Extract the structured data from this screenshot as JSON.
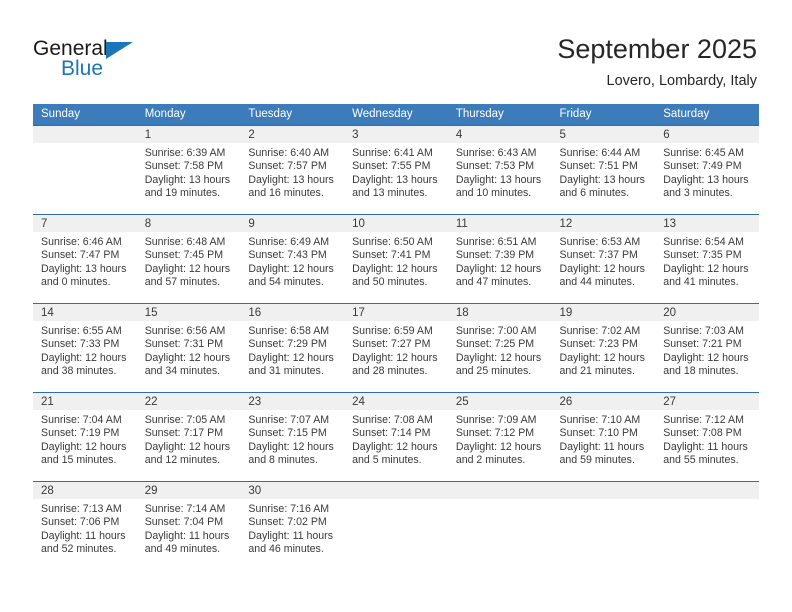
{
  "brand": {
    "name_top": "General",
    "name_bottom": "Blue",
    "accent_color": "#1b75bb",
    "triangle_icon": "triangle-icon"
  },
  "header": {
    "month_title": "September 2025",
    "location": "Lovero, Lombardy, Italy"
  },
  "theme": {
    "header_bg": "#3c7cba",
    "header_text": "#ffffff",
    "daynum_band_bg": "#f0f0f0",
    "week_separator": "#2f6fa8",
    "body_text": "#3a3a3a"
  },
  "weekday_headers": [
    "Sunday",
    "Monday",
    "Tuesday",
    "Wednesday",
    "Thursday",
    "Friday",
    "Saturday"
  ],
  "weeks": [
    [
      {
        "day": "",
        "sunrise": "",
        "sunset": "",
        "daylight1": "",
        "daylight2": ""
      },
      {
        "day": "1",
        "sunrise": "Sunrise: 6:39 AM",
        "sunset": "Sunset: 7:58 PM",
        "daylight1": "Daylight: 13 hours",
        "daylight2": "and 19 minutes."
      },
      {
        "day": "2",
        "sunrise": "Sunrise: 6:40 AM",
        "sunset": "Sunset: 7:57 PM",
        "daylight1": "Daylight: 13 hours",
        "daylight2": "and 16 minutes."
      },
      {
        "day": "3",
        "sunrise": "Sunrise: 6:41 AM",
        "sunset": "Sunset: 7:55 PM",
        "daylight1": "Daylight: 13 hours",
        "daylight2": "and 13 minutes."
      },
      {
        "day": "4",
        "sunrise": "Sunrise: 6:43 AM",
        "sunset": "Sunset: 7:53 PM",
        "daylight1": "Daylight: 13 hours",
        "daylight2": "and 10 minutes."
      },
      {
        "day": "5",
        "sunrise": "Sunrise: 6:44 AM",
        "sunset": "Sunset: 7:51 PM",
        "daylight1": "Daylight: 13 hours",
        "daylight2": "and 6 minutes."
      },
      {
        "day": "6",
        "sunrise": "Sunrise: 6:45 AM",
        "sunset": "Sunset: 7:49 PM",
        "daylight1": "Daylight: 13 hours",
        "daylight2": "and 3 minutes."
      }
    ],
    [
      {
        "day": "7",
        "sunrise": "Sunrise: 6:46 AM",
        "sunset": "Sunset: 7:47 PM",
        "daylight1": "Daylight: 13 hours",
        "daylight2": "and 0 minutes."
      },
      {
        "day": "8",
        "sunrise": "Sunrise: 6:48 AM",
        "sunset": "Sunset: 7:45 PM",
        "daylight1": "Daylight: 12 hours",
        "daylight2": "and 57 minutes."
      },
      {
        "day": "9",
        "sunrise": "Sunrise: 6:49 AM",
        "sunset": "Sunset: 7:43 PM",
        "daylight1": "Daylight: 12 hours",
        "daylight2": "and 54 minutes."
      },
      {
        "day": "10",
        "sunrise": "Sunrise: 6:50 AM",
        "sunset": "Sunset: 7:41 PM",
        "daylight1": "Daylight: 12 hours",
        "daylight2": "and 50 minutes."
      },
      {
        "day": "11",
        "sunrise": "Sunrise: 6:51 AM",
        "sunset": "Sunset: 7:39 PM",
        "daylight1": "Daylight: 12 hours",
        "daylight2": "and 47 minutes."
      },
      {
        "day": "12",
        "sunrise": "Sunrise: 6:53 AM",
        "sunset": "Sunset: 7:37 PM",
        "daylight1": "Daylight: 12 hours",
        "daylight2": "and 44 minutes."
      },
      {
        "day": "13",
        "sunrise": "Sunrise: 6:54 AM",
        "sunset": "Sunset: 7:35 PM",
        "daylight1": "Daylight: 12 hours",
        "daylight2": "and 41 minutes."
      }
    ],
    [
      {
        "day": "14",
        "sunrise": "Sunrise: 6:55 AM",
        "sunset": "Sunset: 7:33 PM",
        "daylight1": "Daylight: 12 hours",
        "daylight2": "and 38 minutes."
      },
      {
        "day": "15",
        "sunrise": "Sunrise: 6:56 AM",
        "sunset": "Sunset: 7:31 PM",
        "daylight1": "Daylight: 12 hours",
        "daylight2": "and 34 minutes."
      },
      {
        "day": "16",
        "sunrise": "Sunrise: 6:58 AM",
        "sunset": "Sunset: 7:29 PM",
        "daylight1": "Daylight: 12 hours",
        "daylight2": "and 31 minutes."
      },
      {
        "day": "17",
        "sunrise": "Sunrise: 6:59 AM",
        "sunset": "Sunset: 7:27 PM",
        "daylight1": "Daylight: 12 hours",
        "daylight2": "and 28 minutes."
      },
      {
        "day": "18",
        "sunrise": "Sunrise: 7:00 AM",
        "sunset": "Sunset: 7:25 PM",
        "daylight1": "Daylight: 12 hours",
        "daylight2": "and 25 minutes."
      },
      {
        "day": "19",
        "sunrise": "Sunrise: 7:02 AM",
        "sunset": "Sunset: 7:23 PM",
        "daylight1": "Daylight: 12 hours",
        "daylight2": "and 21 minutes."
      },
      {
        "day": "20",
        "sunrise": "Sunrise: 7:03 AM",
        "sunset": "Sunset: 7:21 PM",
        "daylight1": "Daylight: 12 hours",
        "daylight2": "and 18 minutes."
      }
    ],
    [
      {
        "day": "21",
        "sunrise": "Sunrise: 7:04 AM",
        "sunset": "Sunset: 7:19 PM",
        "daylight1": "Daylight: 12 hours",
        "daylight2": "and 15 minutes."
      },
      {
        "day": "22",
        "sunrise": "Sunrise: 7:05 AM",
        "sunset": "Sunset: 7:17 PM",
        "daylight1": "Daylight: 12 hours",
        "daylight2": "and 12 minutes."
      },
      {
        "day": "23",
        "sunrise": "Sunrise: 7:07 AM",
        "sunset": "Sunset: 7:15 PM",
        "daylight1": "Daylight: 12 hours",
        "daylight2": "and 8 minutes."
      },
      {
        "day": "24",
        "sunrise": "Sunrise: 7:08 AM",
        "sunset": "Sunset: 7:14 PM",
        "daylight1": "Daylight: 12 hours",
        "daylight2": "and 5 minutes."
      },
      {
        "day": "25",
        "sunrise": "Sunrise: 7:09 AM",
        "sunset": "Sunset: 7:12 PM",
        "daylight1": "Daylight: 12 hours",
        "daylight2": "and 2 minutes."
      },
      {
        "day": "26",
        "sunrise": "Sunrise: 7:10 AM",
        "sunset": "Sunset: 7:10 PM",
        "daylight1": "Daylight: 11 hours",
        "daylight2": "and 59 minutes."
      },
      {
        "day": "27",
        "sunrise": "Sunrise: 7:12 AM",
        "sunset": "Sunset: 7:08 PM",
        "daylight1": "Daylight: 11 hours",
        "daylight2": "and 55 minutes."
      }
    ],
    [
      {
        "day": "28",
        "sunrise": "Sunrise: 7:13 AM",
        "sunset": "Sunset: 7:06 PM",
        "daylight1": "Daylight: 11 hours",
        "daylight2": "and 52 minutes."
      },
      {
        "day": "29",
        "sunrise": "Sunrise: 7:14 AM",
        "sunset": "Sunset: 7:04 PM",
        "daylight1": "Daylight: 11 hours",
        "daylight2": "and 49 minutes."
      },
      {
        "day": "30",
        "sunrise": "Sunrise: 7:16 AM",
        "sunset": "Sunset: 7:02 PM",
        "daylight1": "Daylight: 11 hours",
        "daylight2": "and 46 minutes."
      },
      {
        "day": "",
        "sunrise": "",
        "sunset": "",
        "daylight1": "",
        "daylight2": ""
      },
      {
        "day": "",
        "sunrise": "",
        "sunset": "",
        "daylight1": "",
        "daylight2": ""
      },
      {
        "day": "",
        "sunrise": "",
        "sunset": "",
        "daylight1": "",
        "daylight2": ""
      },
      {
        "day": "",
        "sunrise": "",
        "sunset": "",
        "daylight1": "",
        "daylight2": ""
      }
    ]
  ]
}
